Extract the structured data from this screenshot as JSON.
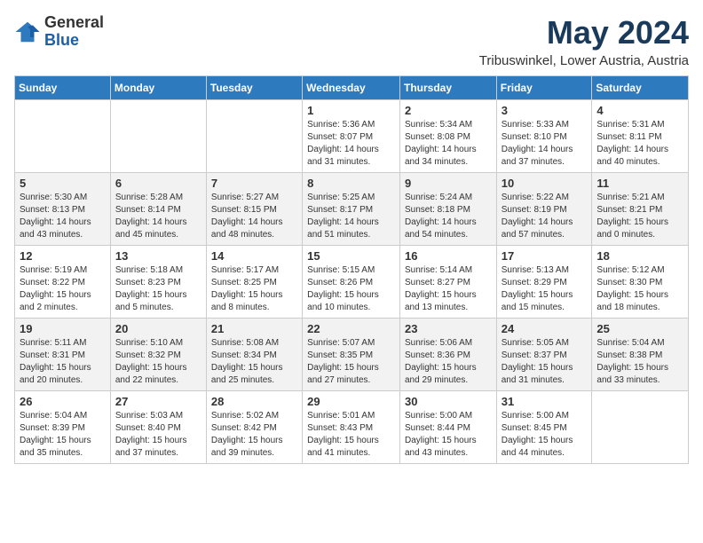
{
  "logo": {
    "general": "General",
    "blue": "Blue"
  },
  "header": {
    "month": "May 2024",
    "location": "Tribuswinkel, Lower Austria, Austria"
  },
  "weekdays": [
    "Sunday",
    "Monday",
    "Tuesday",
    "Wednesday",
    "Thursday",
    "Friday",
    "Saturday"
  ],
  "weeks": [
    [
      {
        "day": null,
        "info": null
      },
      {
        "day": null,
        "info": null
      },
      {
        "day": null,
        "info": null
      },
      {
        "day": "1",
        "info": "Sunrise: 5:36 AM\nSunset: 8:07 PM\nDaylight: 14 hours\nand 31 minutes."
      },
      {
        "day": "2",
        "info": "Sunrise: 5:34 AM\nSunset: 8:08 PM\nDaylight: 14 hours\nand 34 minutes."
      },
      {
        "day": "3",
        "info": "Sunrise: 5:33 AM\nSunset: 8:10 PM\nDaylight: 14 hours\nand 37 minutes."
      },
      {
        "day": "4",
        "info": "Sunrise: 5:31 AM\nSunset: 8:11 PM\nDaylight: 14 hours\nand 40 minutes."
      }
    ],
    [
      {
        "day": "5",
        "info": "Sunrise: 5:30 AM\nSunset: 8:13 PM\nDaylight: 14 hours\nand 43 minutes."
      },
      {
        "day": "6",
        "info": "Sunrise: 5:28 AM\nSunset: 8:14 PM\nDaylight: 14 hours\nand 45 minutes."
      },
      {
        "day": "7",
        "info": "Sunrise: 5:27 AM\nSunset: 8:15 PM\nDaylight: 14 hours\nand 48 minutes."
      },
      {
        "day": "8",
        "info": "Sunrise: 5:25 AM\nSunset: 8:17 PM\nDaylight: 14 hours\nand 51 minutes."
      },
      {
        "day": "9",
        "info": "Sunrise: 5:24 AM\nSunset: 8:18 PM\nDaylight: 14 hours\nand 54 minutes."
      },
      {
        "day": "10",
        "info": "Sunrise: 5:22 AM\nSunset: 8:19 PM\nDaylight: 14 hours\nand 57 minutes."
      },
      {
        "day": "11",
        "info": "Sunrise: 5:21 AM\nSunset: 8:21 PM\nDaylight: 15 hours\nand 0 minutes."
      }
    ],
    [
      {
        "day": "12",
        "info": "Sunrise: 5:19 AM\nSunset: 8:22 PM\nDaylight: 15 hours\nand 2 minutes."
      },
      {
        "day": "13",
        "info": "Sunrise: 5:18 AM\nSunset: 8:23 PM\nDaylight: 15 hours\nand 5 minutes."
      },
      {
        "day": "14",
        "info": "Sunrise: 5:17 AM\nSunset: 8:25 PM\nDaylight: 15 hours\nand 8 minutes."
      },
      {
        "day": "15",
        "info": "Sunrise: 5:15 AM\nSunset: 8:26 PM\nDaylight: 15 hours\nand 10 minutes."
      },
      {
        "day": "16",
        "info": "Sunrise: 5:14 AM\nSunset: 8:27 PM\nDaylight: 15 hours\nand 13 minutes."
      },
      {
        "day": "17",
        "info": "Sunrise: 5:13 AM\nSunset: 8:29 PM\nDaylight: 15 hours\nand 15 minutes."
      },
      {
        "day": "18",
        "info": "Sunrise: 5:12 AM\nSunset: 8:30 PM\nDaylight: 15 hours\nand 18 minutes."
      }
    ],
    [
      {
        "day": "19",
        "info": "Sunrise: 5:11 AM\nSunset: 8:31 PM\nDaylight: 15 hours\nand 20 minutes."
      },
      {
        "day": "20",
        "info": "Sunrise: 5:10 AM\nSunset: 8:32 PM\nDaylight: 15 hours\nand 22 minutes."
      },
      {
        "day": "21",
        "info": "Sunrise: 5:08 AM\nSunset: 8:34 PM\nDaylight: 15 hours\nand 25 minutes."
      },
      {
        "day": "22",
        "info": "Sunrise: 5:07 AM\nSunset: 8:35 PM\nDaylight: 15 hours\nand 27 minutes."
      },
      {
        "day": "23",
        "info": "Sunrise: 5:06 AM\nSunset: 8:36 PM\nDaylight: 15 hours\nand 29 minutes."
      },
      {
        "day": "24",
        "info": "Sunrise: 5:05 AM\nSunset: 8:37 PM\nDaylight: 15 hours\nand 31 minutes."
      },
      {
        "day": "25",
        "info": "Sunrise: 5:04 AM\nSunset: 8:38 PM\nDaylight: 15 hours\nand 33 minutes."
      }
    ],
    [
      {
        "day": "26",
        "info": "Sunrise: 5:04 AM\nSunset: 8:39 PM\nDaylight: 15 hours\nand 35 minutes."
      },
      {
        "day": "27",
        "info": "Sunrise: 5:03 AM\nSunset: 8:40 PM\nDaylight: 15 hours\nand 37 minutes."
      },
      {
        "day": "28",
        "info": "Sunrise: 5:02 AM\nSunset: 8:42 PM\nDaylight: 15 hours\nand 39 minutes."
      },
      {
        "day": "29",
        "info": "Sunrise: 5:01 AM\nSunset: 8:43 PM\nDaylight: 15 hours\nand 41 minutes."
      },
      {
        "day": "30",
        "info": "Sunrise: 5:00 AM\nSunset: 8:44 PM\nDaylight: 15 hours\nand 43 minutes."
      },
      {
        "day": "31",
        "info": "Sunrise: 5:00 AM\nSunset: 8:45 PM\nDaylight: 15 hours\nand 44 minutes."
      },
      {
        "day": null,
        "info": null
      }
    ]
  ]
}
